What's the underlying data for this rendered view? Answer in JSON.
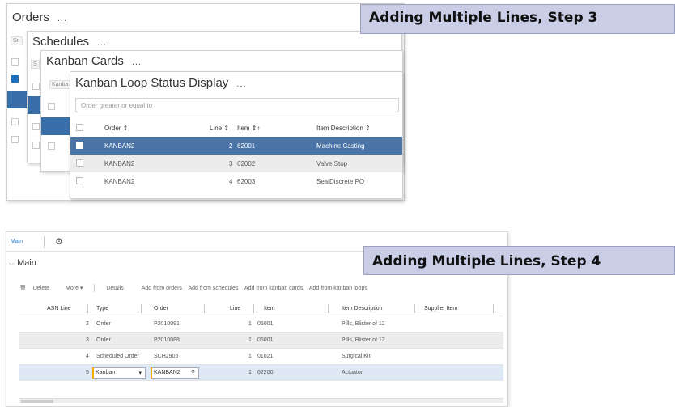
{
  "callouts": {
    "step3": "Adding Multiple Lines, Step 3",
    "step4": "Adding Multiple Lines, Step 4"
  },
  "panels": {
    "orders_title": "Orders",
    "schedules_title": "Schedules",
    "kanban_cards_title": "Kanban Cards",
    "loop_title": "Kanban Loop Status Display",
    "more_dots": "..."
  },
  "loop_grid": {
    "filter_placeholder": "Order greater or equal to",
    "columns": {
      "order": "Order ⇕",
      "line": "Line ⇕",
      "item": "Item ⇕↑",
      "desc": "Item Description ⇕"
    },
    "rows": [
      {
        "order": "KANBAN2",
        "line": "2",
        "item": "62001",
        "desc": "Machine Casting"
      },
      {
        "order": "KANBAN2",
        "line": "3",
        "item": "62002",
        "desc": "Valve Stop"
      },
      {
        "order": "KANBAN2",
        "line": "4",
        "item": "62003",
        "desc": "SealDiscrete PO"
      }
    ]
  },
  "asn_form": {
    "tab_main": "Main",
    "section_title": "Main",
    "toolbar": {
      "delete": "Delete",
      "more": "More ▾",
      "details": "Details",
      "add_orders": "Add from orders",
      "add_schedules": "Add from schedules",
      "add_kanban_cards": "Add from kanban cards",
      "add_kanban_loops": "Add from kanban loops"
    },
    "columns": {
      "asn_line": "ASN Line",
      "type": "Type",
      "order": "Order",
      "line": "Line",
      "item": "Item",
      "desc": "Item Description",
      "supplier": "Supplier Item"
    },
    "rows": [
      {
        "asn_line": "2",
        "type": "Order",
        "order": "P2010091",
        "line": "1",
        "item": "05001",
        "desc": "Pills, Blister of 12"
      },
      {
        "asn_line": "3",
        "type": "Order",
        "order": "P2010088",
        "line": "1",
        "item": "05001",
        "desc": "Pills, Blister of 12"
      },
      {
        "asn_line": "4",
        "type": "Scheduled Order",
        "order": "SCH2905",
        "line": "1",
        "item": "01021",
        "desc": "Surgical Kit"
      },
      {
        "asn_line": "5",
        "type": "Kanban",
        "order": "KANBAN2",
        "line": "1",
        "item": "62200",
        "desc": "Actuator"
      }
    ]
  },
  "colors": {
    "selected_row": "#4b74a6",
    "accent": "#1f6fbf",
    "callout_bg": "#c9cde6"
  }
}
